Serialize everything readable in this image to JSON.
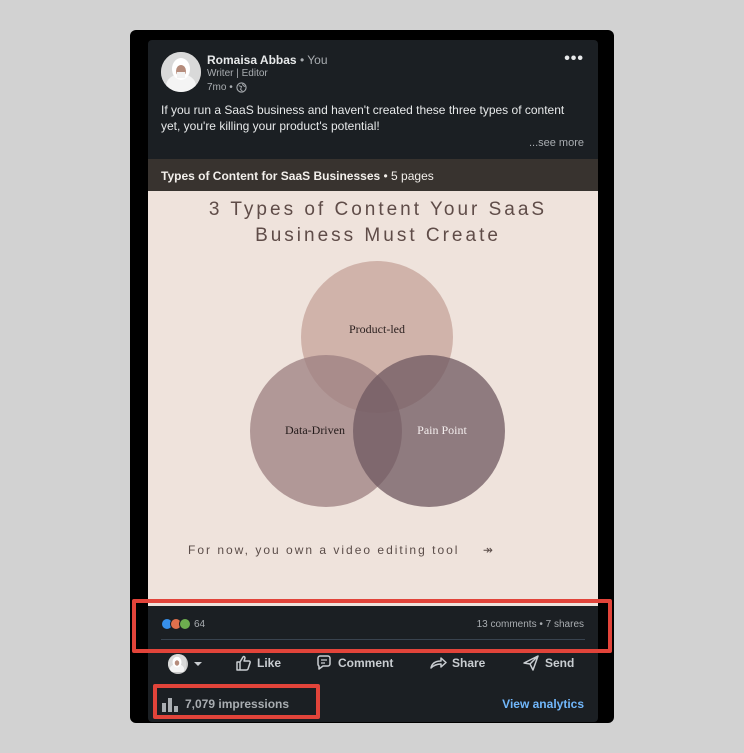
{
  "post": {
    "author_name": "Romaisa Abbas",
    "author_suffix": "• You",
    "headline": "Writer | Editor",
    "time": "7mo •",
    "more_label": "•••",
    "text": "If you run a SaaS business and haven't created these three types of content yet, you're killing your product's potential!",
    "see_more": "...see more"
  },
  "document": {
    "title": "Types of Content for SaaS Businesses",
    "pages": "• 5 pages",
    "slide_title_line1": "3 Types of Content Your SaaS",
    "slide_title_line2": "Business Must Create",
    "circle_top": "Product-led",
    "circle_left": "Data-Driven",
    "circle_right": "Pain Point",
    "footer_text": "For now, you own a video editing tool",
    "footer_arrow": "↠"
  },
  "stats": {
    "reactions_count": "64",
    "comments_shares": "13 comments • 7 shares",
    "reaction_icons": [
      "like-icon",
      "love-icon",
      "celebrate-icon"
    ]
  },
  "actions": {
    "like": "Like",
    "comment": "Comment",
    "share": "Share",
    "send": "Send"
  },
  "footer": {
    "impressions": "7,079 impressions",
    "view_analytics": "View analytics"
  },
  "colors": {
    "card_bg": "#1b1f23",
    "slide_bg": "#efe3dc",
    "link": "#71b7fb",
    "highlight": "#e2443a"
  }
}
